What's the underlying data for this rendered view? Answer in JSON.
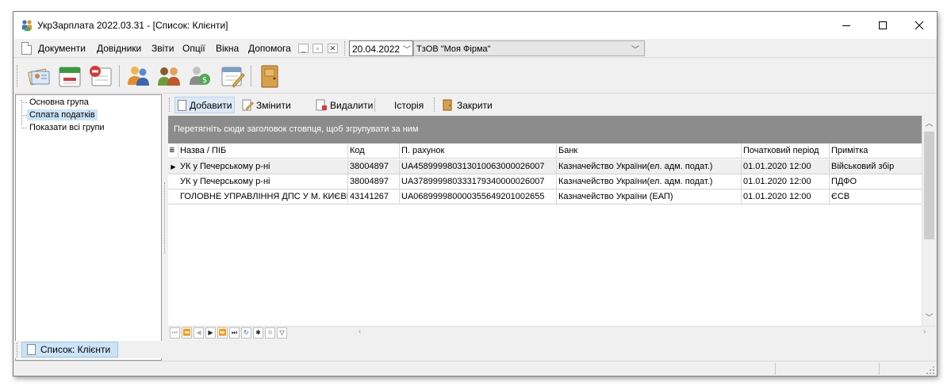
{
  "window": {
    "title": "УкрЗарплата 2022.03.31 - [Список: Клієнти]"
  },
  "menu": {
    "items": [
      "Документи",
      "Довідники",
      "Звіти",
      "Опції",
      "Вікна",
      "Допомога"
    ],
    "date": "20.04.2022",
    "company": "ТзОВ \"Моя Фірма\""
  },
  "tree": {
    "items": [
      "Основна група",
      "Сплата податків",
      "Показати всі групи"
    ],
    "selected_index": 1
  },
  "actions": {
    "add": "Добавити",
    "edit": "Змінити",
    "delete": "Видалити",
    "history": "Історія",
    "close": "Закрити"
  },
  "grid": {
    "group_hint": "Перетягніть сюди заголовок стовпця, щоб згрупувати за ним",
    "columns": [
      "Назва / ПІБ",
      "Код",
      "П. рахунок",
      "Банк",
      "Початковий період",
      "Примітка"
    ],
    "rows": [
      [
        "УК у Печерському р-ні",
        "38004897",
        "UA458999980313010063000026007",
        "Казначейство України(ел. адм. подат.)",
        "01.01.2020 12:00",
        "Військовий збір"
      ],
      [
        "УК у Печерському р-ні",
        "38004897",
        "UA378999980333179340000026007",
        "Казначейство України(ел. адм. подат.)",
        "01.01.2020 12:00",
        "ПДФО"
      ],
      [
        "ГОЛОВНЕ УПРАВЛІННЯ ДПС У М. КИЄВІ",
        "43141267",
        "UA068999980000355649201002655",
        "Казначейство України (ЕАП)",
        "01.01.2020 12:00",
        "ЄСВ"
      ]
    ]
  },
  "taskbar": {
    "active_window": "Список: Клієнти"
  },
  "colors": {
    "selection": "#cce4f7",
    "group_panel": "#8c8c8c",
    "accent_border": "#99c9ef"
  }
}
